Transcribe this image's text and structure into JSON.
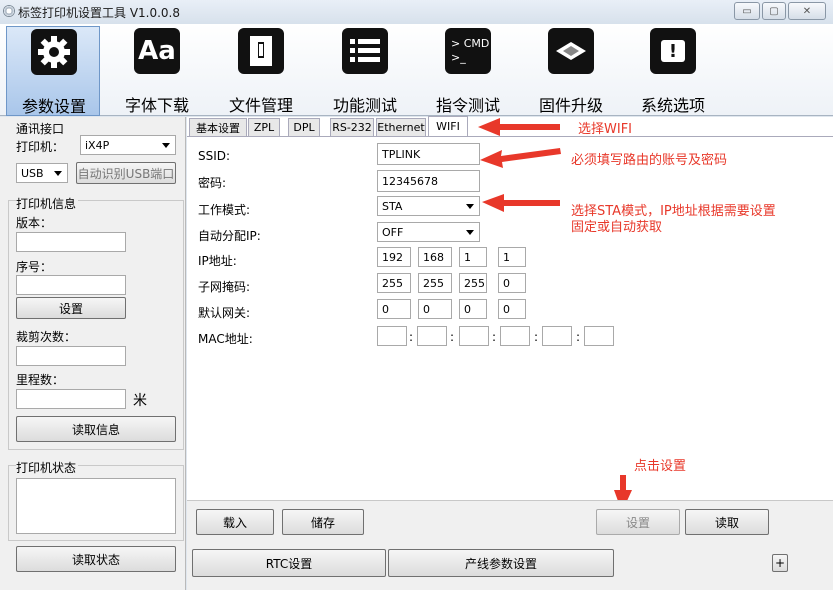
{
  "window": {
    "title": "标签打印机设置工具 V1.0.0.8",
    "min": "▭",
    "max": "▢",
    "close": "✕"
  },
  "toolbar": [
    {
      "label": "参数设置",
      "icon": "gear-icon"
    },
    {
      "label": "字体下载",
      "icon": "font-icon"
    },
    {
      "label": "文件管理",
      "icon": "file-icon"
    },
    {
      "label": "功能测试",
      "icon": "list-icon"
    },
    {
      "label": "指令测试",
      "icon": "cmd-icon"
    },
    {
      "label": "固件升级",
      "icon": "chip-icon"
    },
    {
      "label": "系统选项",
      "icon": "alert-icon"
    }
  ],
  "icons": {
    "font_text": "Aa",
    "cmd_line1": "> CMD",
    "cmd_line2": ">_",
    "alert_text": "!"
  },
  "left": {
    "comm_title": "通讯接口",
    "printer_label": "打印机：",
    "printer_value": "iX4P",
    "port_value": "USB",
    "auto_usb": "自动识别USB端口",
    "info_title": "打印机信息",
    "version_label": "版本：",
    "serial_label": "序号：",
    "set_button": "设置",
    "cut_label": "裁剪次数：",
    "mileage_label": "里程数：",
    "mileage_unit": "米",
    "read_info": "读取信息",
    "status_title": "打印机状态",
    "read_status": "读取状态"
  },
  "tabs": [
    "基本设置",
    "ZPL",
    "DPL",
    "RS-232",
    "Ethernet",
    "WIFI"
  ],
  "wifi": {
    "ssid_label": "SSID:",
    "ssid_value": "TPLINK",
    "pwd_label": "密码:",
    "pwd_value": "12345678",
    "mode_label": "工作模式:",
    "mode_value": "STA",
    "dhcp_label": "自动分配IP:",
    "dhcp_value": "OFF",
    "ip_label": "IP地址:",
    "ip": [
      "192",
      "168",
      "1",
      "1"
    ],
    "mask_label": "子网掩码:",
    "mask": [
      "255",
      "255",
      "255",
      "0"
    ],
    "gw_label": "默认网关:",
    "gw": [
      "0",
      "0",
      "0",
      "0"
    ],
    "mac_label": "MAC地址:",
    "mac_sep": ":"
  },
  "notes": {
    "n1": "选择WIFI",
    "n2": "必须填写路由的账号及密码",
    "n3a": "选择STA模式，IP地址根据需要设置",
    "n3b": "固定或自动获取",
    "n4": "点击设置"
  },
  "bottom": {
    "load": "载入",
    "save": "储存",
    "set": "设置",
    "read": "读取",
    "rtc": "RTC设置",
    "line": "产线参数设置",
    "plus": "+"
  },
  "colors": {
    "annotation": "#e8382a",
    "toolbar_active": "#a9c6ea"
  }
}
